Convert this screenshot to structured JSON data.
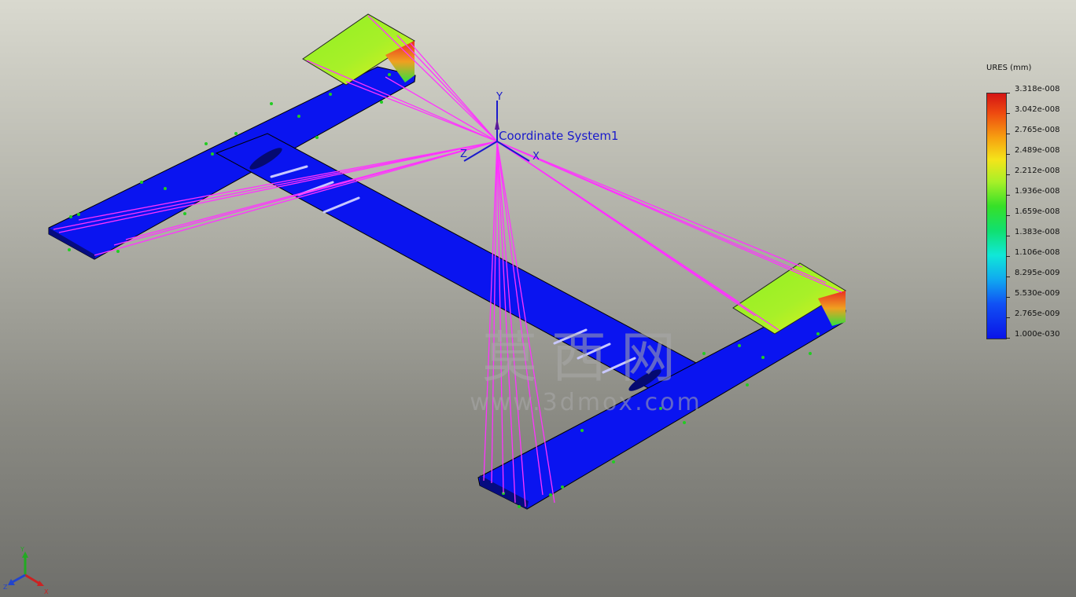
{
  "viewport": {
    "coordinate_system_label": "Coordinate System1",
    "axes": {
      "x": "X",
      "y": "Y",
      "z": "Z"
    }
  },
  "legend": {
    "title": "URES (mm)",
    "values": [
      "3.318e-008",
      "3.042e-008",
      "2.765e-008",
      "2.489e-008",
      "2.212e-008",
      "1.936e-008",
      "1.659e-008",
      "1.383e-008",
      "1.106e-008",
      "8.295e-009",
      "5.530e-009",
      "2.765e-009",
      "1.000e-030"
    ]
  },
  "watermark": {
    "chinese": "莫西网",
    "url": "www.3dmox.com"
  },
  "triad": {
    "x": "X",
    "y": "Y",
    "z": "Z"
  },
  "colors": {
    "model_body": "#0a14f0",
    "connector_lines": "#ff33ff",
    "fixture_markers": "#22cc22",
    "axis_color": "#1a1acc"
  }
}
